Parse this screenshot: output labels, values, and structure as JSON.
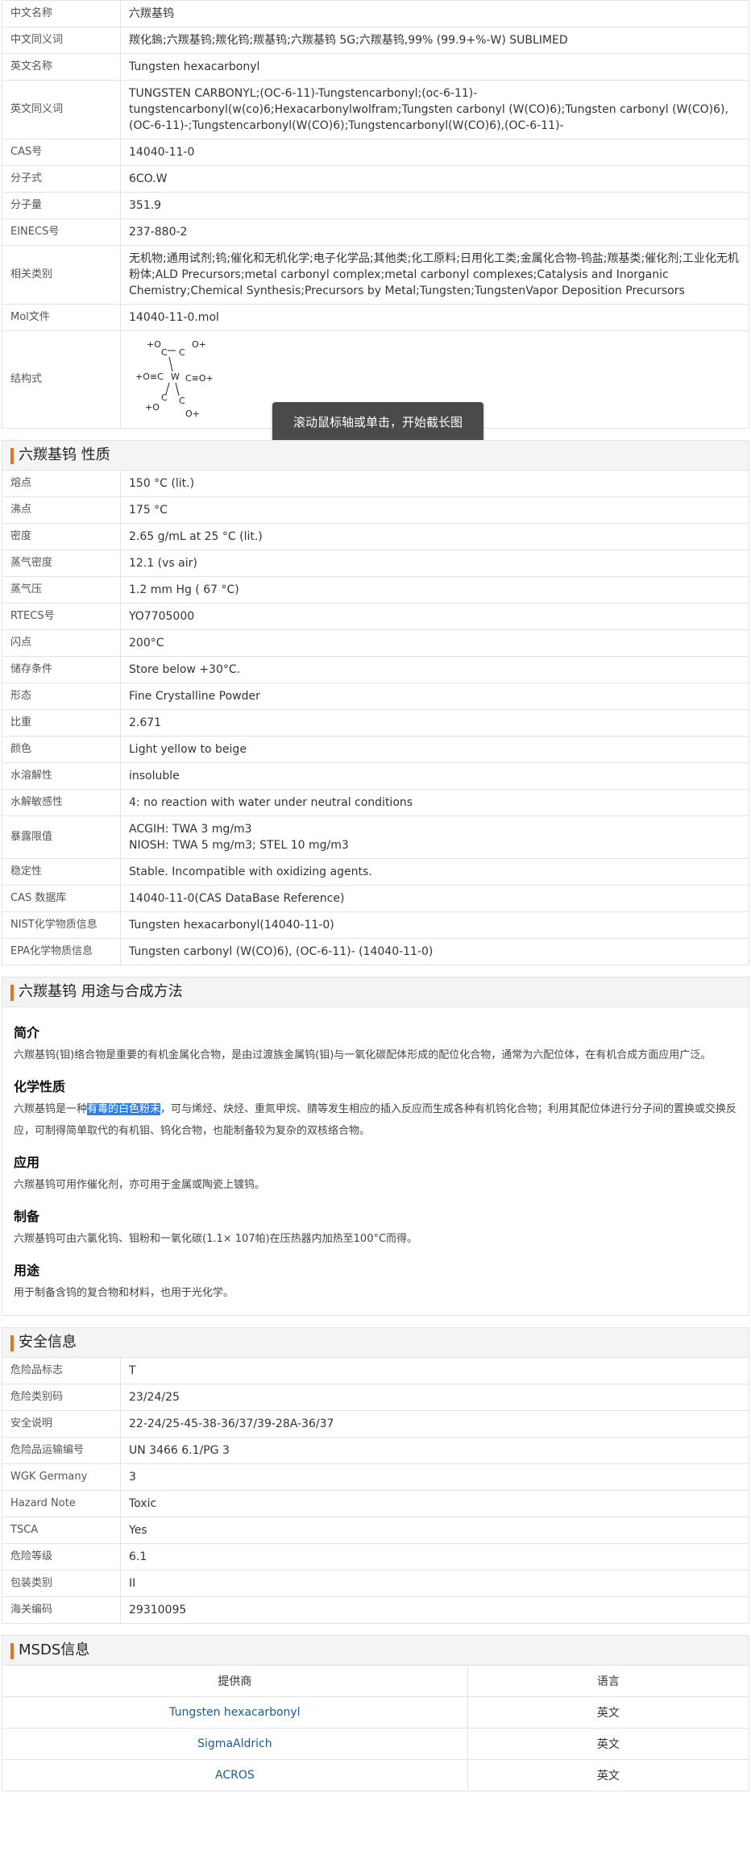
{
  "basic": {
    "rows": [
      {
        "key": "中文名称",
        "value": "六羰基钨",
        "link": true
      },
      {
        "key": "中文同义词",
        "value": "羰化鎢;六羰基钨;羰化钨;羰基钨;六羰基钨 5G;六羰基钨,99% (99.9+%-W) SUBLIMED",
        "link": false
      },
      {
        "key": "英文名称",
        "value": "Tungsten hexacarbonyl",
        "link": false
      },
      {
        "key": "英文同义词",
        "value": "TUNGSTEN CARBONYL;(OC-6-11)-Tungstencarbonyl;(oc-6-11)-tungstencarbonyl(w(co)6;Hexacarbonylwolfram;Tungsten carbonyl (W(CO)6);Tungsten carbonyl (W(CO)6), (OC-6-11)-;Tungstencarbonyl(W(CO)6);Tungstencarbonyl(W(CO)6),(OC-6-11)-",
        "link": false
      },
      {
        "key": "CAS号",
        "value": "14040-11-0",
        "link": false
      },
      {
        "key": "分子式",
        "value": "6CO.W",
        "link": false
      },
      {
        "key": "分子量",
        "value": "351.9",
        "link": false
      },
      {
        "key": "EINECS号",
        "value": "237-880-2",
        "link": false
      },
      {
        "key": "相关类别",
        "value": "无机物;通用试剂;钨;催化和无机化学;电子化学品;其他类;化工原料;日用化工类;金属化合物-钨盐;羰基类;催化剂;工业化无机粉体;ALD Precursors;metal carbonyl complex;metal carbonyl complexes;Catalysis and Inorganic Chemistry;Chemical Synthesis;Precursors by Metal;Tungsten;TungstenVapor Deposition Precursors",
        "link": true
      },
      {
        "key": "Mol文件",
        "value": "14040-11-0.mol",
        "link": true
      }
    ],
    "structure_key": "结构式"
  },
  "structure_labels": {
    "o1": "+O",
    "c1": "C",
    "c2": "C",
    "o2": "O+",
    "o3": "+O≡C",
    "w": "W",
    "c3": "C≡O+",
    "o4": "+O",
    "c4": "C",
    "c5": "C",
    "o5": "O+"
  },
  "tooltip": "滚动鼠标轴或单击，开始截长图",
  "properties": {
    "title": "六羰基钨 性质",
    "rows": [
      {
        "key": "熔点",
        "value": "150 °C (lit.)",
        "link": false
      },
      {
        "key": "沸点",
        "value": "175 °C",
        "link": false
      },
      {
        "key": "密度",
        "value": "2.65 g/mL at 25 °C (lit.)",
        "link": false
      },
      {
        "key": "蒸气密度",
        "value": "12.1 (vs air)",
        "link": false
      },
      {
        "key": "蒸气压",
        "value": "1.2 mm Hg ( 67 °C)",
        "link": false
      },
      {
        "key": "RTECS号",
        "value": "YO7705000",
        "link": false
      },
      {
        "key": "闪点",
        "value": "200°C",
        "link": false
      },
      {
        "key": "储存条件",
        "value": "Store below +30°C.",
        "link": false
      },
      {
        "key": "形态",
        "value": "Fine Crystalline Powder",
        "link": false
      },
      {
        "key": "比重",
        "value": "2.671",
        "link": false
      },
      {
        "key": "颜色",
        "value": "Light yellow to beige",
        "link": false
      },
      {
        "key": "水溶解性",
        "value": "insoluble",
        "link": false
      },
      {
        "key": "水解敏感性",
        "value": "4: no reaction with water under neutral conditions",
        "link": false
      },
      {
        "key": "暴露限值",
        "value": "ACGIH: TWA 3 mg/m3\nNIOSH: TWA 5 mg/m3; STEL 10 mg/m3",
        "link": false
      },
      {
        "key": "稳定性",
        "value": "Stable. Incompatible with oxidizing agents.",
        "link": false
      },
      {
        "key": "CAS 数据库",
        "value": "14040-11-0(CAS DataBase Reference)",
        "link": true
      },
      {
        "key": "NIST化学物质信息",
        "value": "Tungsten hexacarbonyl(14040-11-0)",
        "link": true
      },
      {
        "key": "EPA化学物质信息",
        "value": "Tungsten carbonyl (W(CO)6), (OC-6-11)- (14040-11-0)",
        "link": true
      }
    ]
  },
  "usage": {
    "title": "六羰基钨 用途与合成方法",
    "intro_h": "简介",
    "intro_p": "六羰基钨(钼)络合物是重要的有机金属化合物，是由过渡族金属钨(钼)与一氧化碳配体形成的配位化合物，通常为六配位体，在有机合成方面应用广泛。",
    "chem_h": "化学性质",
    "chem_p_pre": "六羰基钨是一种",
    "chem_p_hl": "有毒的白色粉末",
    "chem_p_post": "，可与烯烃、炔烃、重氮甲烷、腈等发生相应的插入反应而生成各种有机钨化合物；利用其配位体进行分子间的置换或交换反应，可制得简单取代的有机钼、钨化合物，也能制备较为复杂的双核络合物。",
    "app_h": "应用",
    "app_p": "六羰基钨可用作催化剂，亦可用于金属或陶瓷上镀钨。",
    "prep_h": "制备",
    "prep_p": "六羰基钨可由六氯化钨、钼粉和一氧化碳(1.1× 107帕)在压热器内加热至100°C而得。",
    "use_h": "用途",
    "use_p": "用于制备含钨的复合物和材料，也用于光化学。"
  },
  "safety": {
    "title": "安全信息",
    "rows": [
      {
        "key": "危险品标志",
        "value": "T",
        "link": true
      },
      {
        "key": "危险类别码",
        "value": "23/24/25",
        "link": true
      },
      {
        "key": "安全说明",
        "value": "22-24/25-45-38-36/37/39-28A-36/37",
        "link": true
      },
      {
        "key": "危险品运输编号",
        "value": "UN 3466 6.1/PG 3",
        "link": false
      },
      {
        "key": "WGK Germany",
        "value": "3",
        "link": false
      },
      {
        "key": "Hazard Note",
        "value": "Toxic",
        "link": false
      },
      {
        "key": "TSCA",
        "value": "Yes",
        "link": false
      },
      {
        "key": "危险等级",
        "value": "6.1",
        "link": false
      },
      {
        "key": "包装类别",
        "value": "II",
        "link": false
      },
      {
        "key": "海关编码",
        "value": "29310095",
        "link": false
      }
    ]
  },
  "msds": {
    "title": "MSDS信息",
    "col_provider": "提供商",
    "col_lang": "语言",
    "rows": [
      {
        "provider": "Tungsten hexacarbonyl",
        "lang": "英文"
      },
      {
        "provider": "SigmaAldrich",
        "lang": "英文"
      },
      {
        "provider": "ACROS",
        "lang": "英文"
      }
    ]
  }
}
